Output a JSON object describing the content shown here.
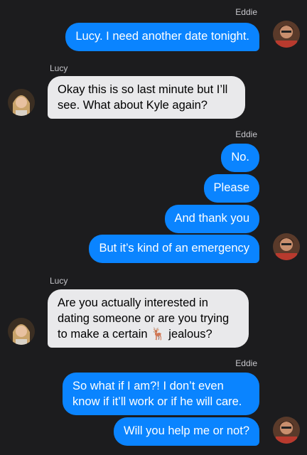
{
  "conversation": {
    "messages": [
      {
        "sender": "Eddie",
        "text": "Lucy. I need another date tonight."
      },
      {
        "sender": "Lucy",
        "text": "Okay this is so last minute but I’ll see. What about Kyle again?"
      },
      {
        "sender": "Eddie",
        "text": "No."
      },
      {
        "sender": "Eddie",
        "text": "Please"
      },
      {
        "sender": "Eddie",
        "text": "And thank you"
      },
      {
        "sender": "Eddie",
        "text": "But it’s kind of an emergency"
      },
      {
        "sender": "Lucy",
        "text": "Are you actually interested in dating someone or are you trying to make a certain 🦌 jealous?"
      },
      {
        "sender": "Eddie",
        "text": "So what if I am?! I don’t even know if it’ll work or if he will care."
      },
      {
        "sender": "Eddie",
        "text": "Will you help me or not?"
      }
    ]
  }
}
